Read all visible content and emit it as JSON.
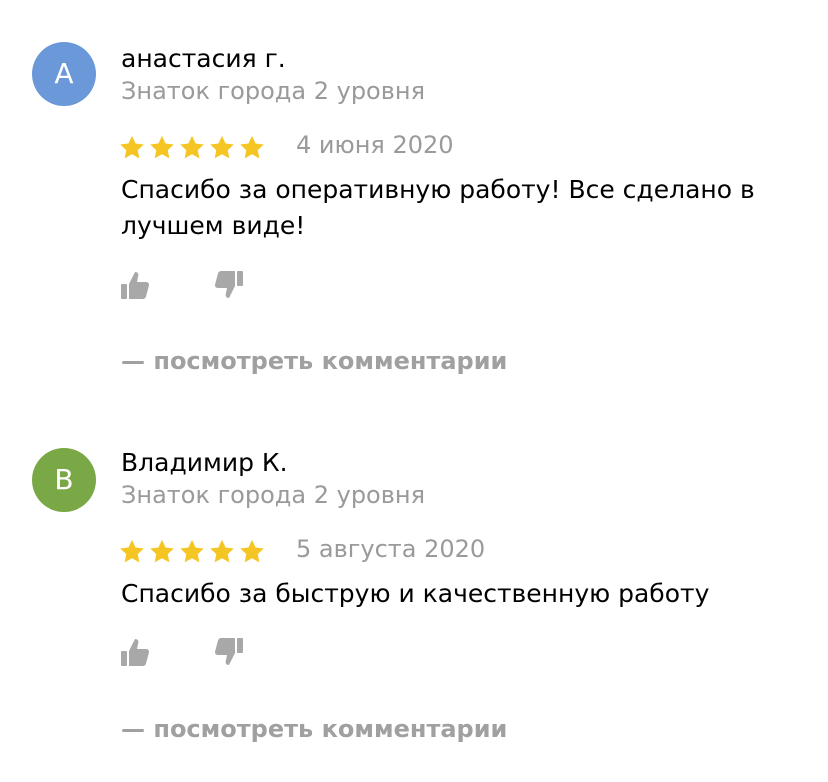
{
  "colors": {
    "star": "#f5c623",
    "muted": "#9a9a9a",
    "avatar_a": "#6a98d9",
    "avatar_b": "#7aa846"
  },
  "reviews": [
    {
      "avatar_letter": "А",
      "name": "анастасия г.",
      "rank": "Знаток города 2 уровня",
      "stars": 5,
      "date": "4 июня 2020",
      "text": "Спасибо за оперативную работу! Все сделано в лучшем виде!",
      "like_icon": "thumbs-up-icon",
      "dislike_icon": "thumbs-down-icon",
      "comments_label": "— посмотреть комментарии"
    },
    {
      "avatar_letter": "В",
      "name": "Владимир К.",
      "rank": "Знаток города 2 уровня",
      "stars": 5,
      "date": "5 августа 2020",
      "text": "Спасибо за быструю и качественную работу",
      "like_icon": "thumbs-up-icon",
      "dislike_icon": "thumbs-down-icon",
      "comments_label": "— посмотреть комментарии"
    }
  ]
}
